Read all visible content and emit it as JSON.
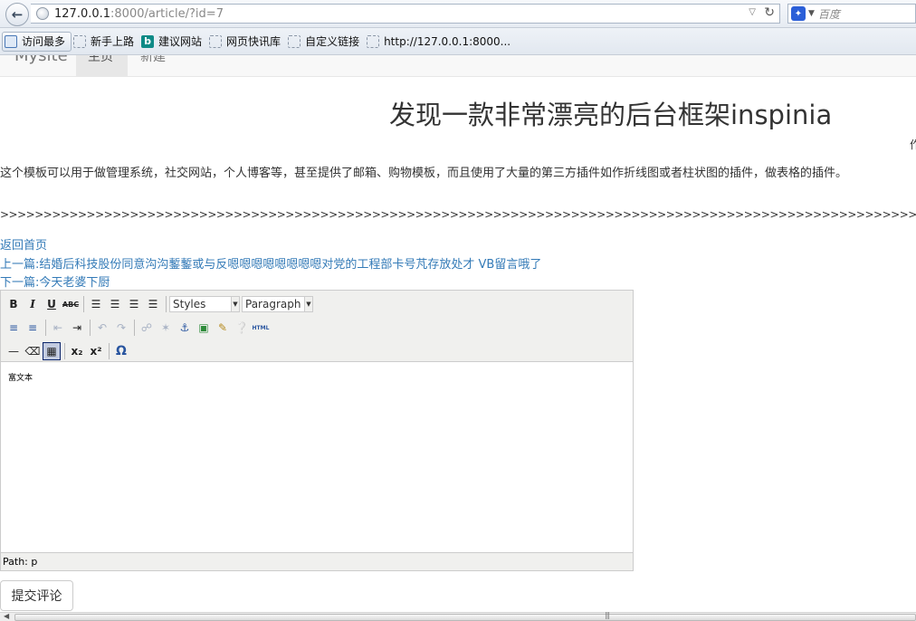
{
  "browser": {
    "url_host": "127.0.0.1",
    "url_rest": ":8000/article/?id=7",
    "search_placeholder": "百度",
    "bookmarks": [
      {
        "label": "访问最多"
      },
      {
        "label": "新手上路"
      },
      {
        "label": "建议网站"
      },
      {
        "label": "网页快讯库"
      },
      {
        "label": "自定义链接"
      },
      {
        "label": "http://127.0.0.1:8000..."
      }
    ]
  },
  "navbar": {
    "brand": "Mysite",
    "home": "主页",
    "new": "新建"
  },
  "article": {
    "title": "发现一款非常漂亮的后台框架inspinia",
    "author_fragment": "作",
    "body": "这个模板可以用于做管理系统，社交网站，个人博客等，甚至提供了邮箱、购物模板，而且使用了大量的第三方插件如作折线图或者柱状图的插件，做表格的插件。",
    "separator": ">>>>>>>>>>>>>>>>>>>>>>>>>>>>>>>>>>>>>>>>>>>>>>>>>>>>>>>>>>>>>>>>>>>>>>>>>>>>>>>>>>>>>>>>>>>>>>>>>>>>>>>>>>>>>>>>>>>>>>>>>>>>>>>>>>>>>>>>>>>>>>>>>>>>>>>>>>>>>>>>>>>>>>>>>>>>>>>>>>>>>>>>>>>>>>>>>>>>>>>>>"
  },
  "links": {
    "back_home": "返回首页",
    "prev": "上一篇:结婚后科技股份同意沟沟鏨鏨或与反嗯嗯嗯嗯嗯嗯嗯嗯对党的工程部卡号芃存放处才 VB留言哦了",
    "next": "下一篇:今天老婆下厨"
  },
  "editor": {
    "styles_select": "Styles",
    "format_select": "Paragraph",
    "content": "富文本",
    "path": "Path: p",
    "html_btn": "HTML"
  },
  "submit_label": "提交评论"
}
